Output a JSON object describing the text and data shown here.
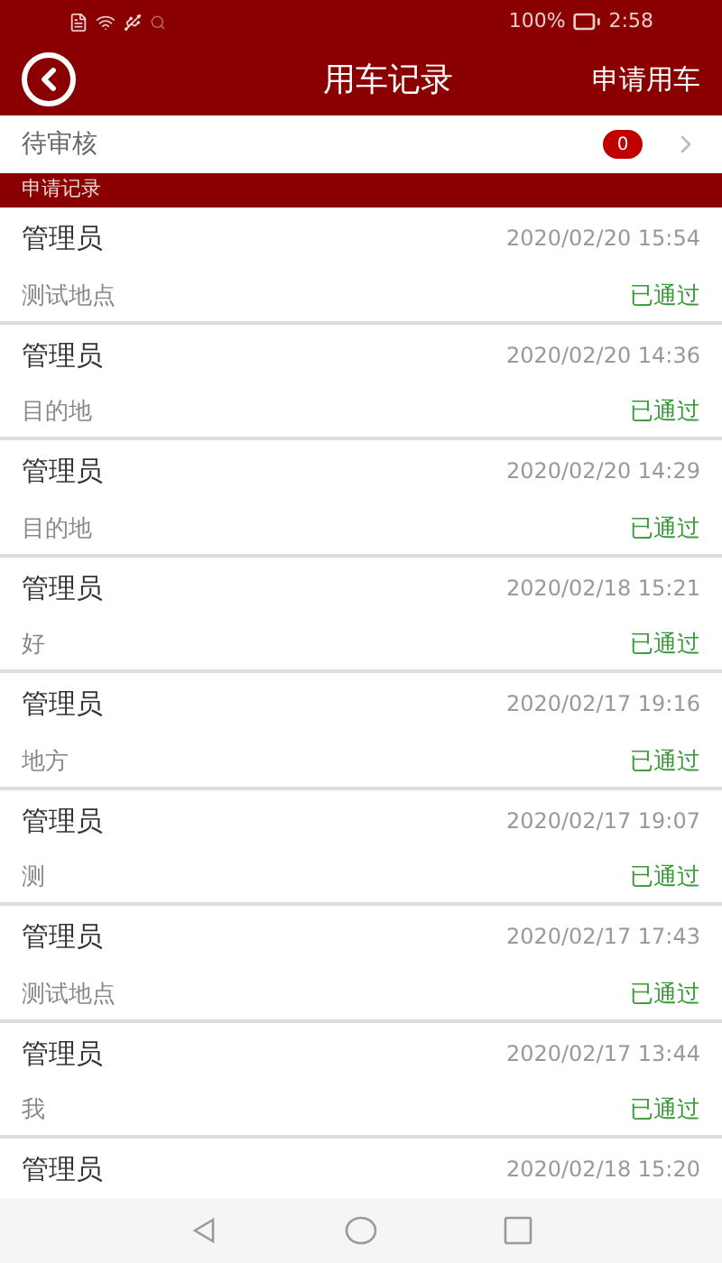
{
  "status_bar": {
    "battery": "100%",
    "time": "2:58"
  },
  "header": {
    "title": "用车记录",
    "action": "申请用车"
  },
  "pending": {
    "label": "待审核",
    "count": "0"
  },
  "section": "申请记录",
  "records": [
    {
      "name": "管理员",
      "time": "2020/02/20 15:54",
      "place": "测试地点",
      "status": "已通过"
    },
    {
      "name": "管理员",
      "time": "2020/02/20 14:36",
      "place": "目的地",
      "status": "已通过"
    },
    {
      "name": "管理员",
      "time": "2020/02/20 14:29",
      "place": "目的地",
      "status": "已通过"
    },
    {
      "name": "管理员",
      "time": "2020/02/18 15:21",
      "place": "好",
      "status": "已通过"
    },
    {
      "name": "管理员",
      "time": "2020/02/17 19:16",
      "place": "地方",
      "status": "已通过"
    },
    {
      "name": "管理员",
      "time": "2020/02/17 19:07",
      "place": "测",
      "status": "已通过"
    },
    {
      "name": "管理员",
      "time": "2020/02/17 17:43",
      "place": "测试地点",
      "status": "已通过"
    },
    {
      "name": "管理员",
      "time": "2020/02/17 13:44",
      "place": "我",
      "status": "已通过"
    },
    {
      "name": "管理员",
      "time": "2020/02/18 15:20"
    }
  ]
}
